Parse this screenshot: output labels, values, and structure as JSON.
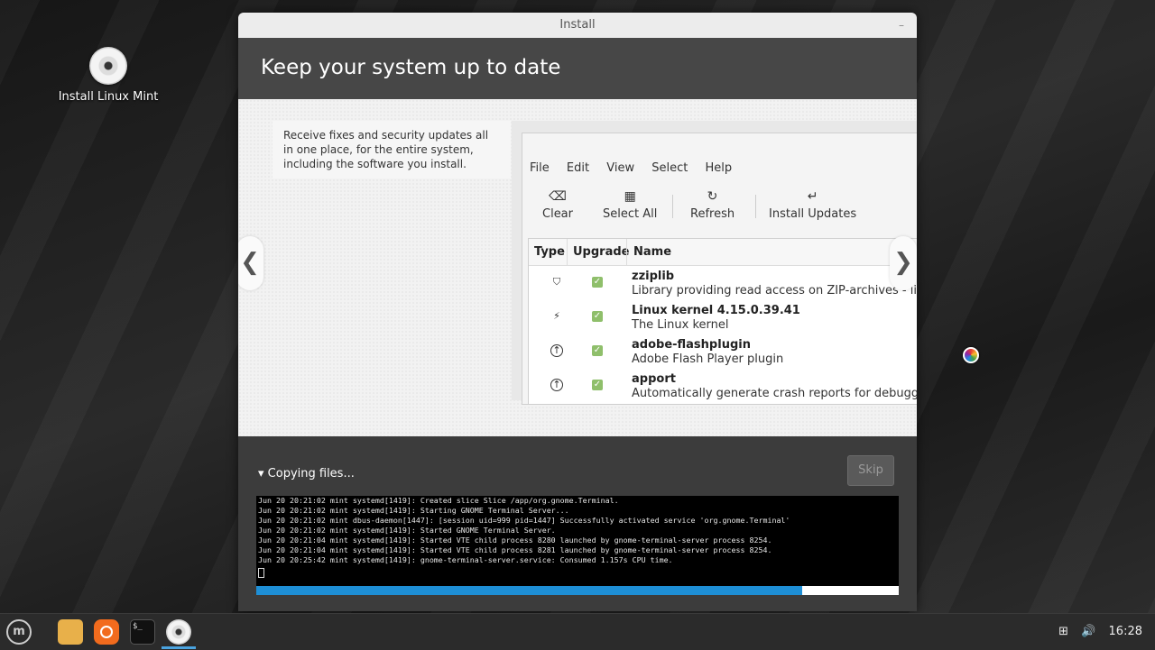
{
  "desktop": {
    "icon_label": "Install Linux Mint"
  },
  "window": {
    "title": "Install",
    "minimize_glyph": "–",
    "heading": "Keep your system up to date"
  },
  "slide": {
    "text": "Receive fixes and security updates all in one place, for the entire system, including the software you install.",
    "prev_glyph": "❮",
    "next_glyph": "❯",
    "update_manager": {
      "menu": [
        "File",
        "Edit",
        "View",
        "Select",
        "Help"
      ],
      "toolbar": {
        "clear": "Clear",
        "select_all": "Select All",
        "refresh": "Refresh",
        "install_updates": "Install Updates"
      },
      "columns": [
        "Type",
        "Upgrade",
        "Name"
      ],
      "rows": [
        {
          "name": "zziplib",
          "desc": "Library providing read access on ZIP-archives - library",
          "type_icon": "shield-icon"
        },
        {
          "name": "Linux kernel 4.15.0.39.41",
          "desc": "The Linux kernel",
          "type_icon": "lightning-icon"
        },
        {
          "name": "adobe-flashplugin",
          "desc": "Adobe Flash Player plugin",
          "type_icon": "upgrade-arrow-icon"
        },
        {
          "name": "apport",
          "desc": "Automatically generate crash reports for debugging",
          "type_icon": "upgrade-arrow-icon"
        }
      ]
    }
  },
  "progress": {
    "status": "Copying files...",
    "skip_label": "Skip",
    "percent": 85,
    "log_lines": [
      "Jun 20 20:21:02 mint systemd[1419]: Created slice Slice /app/org.gnome.Terminal.",
      "Jun 20 20:21:02 mint systemd[1419]: Starting GNOME Terminal Server...",
      "Jun 20 20:21:02 mint dbus-daemon[1447]: [session uid=999 pid=1447] Successfully activated service 'org.gnome.Terminal'",
      "Jun 20 20:21:02 mint systemd[1419]: Started GNOME Terminal Server.",
      "Jun 20 20:21:04 mint systemd[1419]: Started VTE child process 8280 launched by gnome-terminal-server process 8254.",
      "Jun 20 20:21:04 mint systemd[1419]: Started VTE child process 8281 launched by gnome-terminal-server process 8254.",
      "Jun 20 20:25:42 mint systemd[1419]: gnome-terminal-server.service: Consumed 1.157s CPU time."
    ]
  },
  "taskbar": {
    "terminal_glyph": "$_",
    "clock": "16:28"
  },
  "colors": {
    "accent": "#1e8fd6",
    "checkbox": "#8fbf6b"
  }
}
